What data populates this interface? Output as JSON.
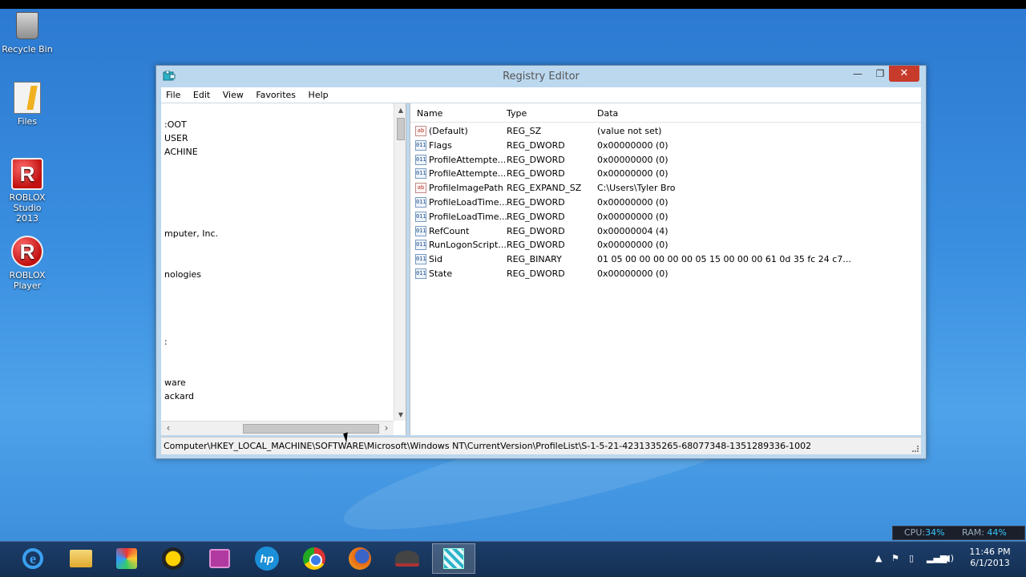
{
  "desktop": {
    "icons": [
      {
        "label": "Recycle Bin"
      },
      {
        "label": "Files"
      },
      {
        "label": "ROBLOX Studio 2013",
        "glyph": "R"
      },
      {
        "label": "ROBLOX Player",
        "glyph": "R"
      }
    ]
  },
  "window": {
    "title": "Registry Editor",
    "controls": {
      "minimize": "—",
      "maximize": "❐",
      "close": "✕"
    },
    "menu": [
      "File",
      "Edit",
      "View",
      "Favorites",
      "Help"
    ]
  },
  "tree": {
    "items": [
      ":OOT",
      "USER",
      "ACHINE",
      "mputer, Inc.",
      "nologies",
      ":",
      "ware",
      "ackard"
    ]
  },
  "list": {
    "columns": [
      "Name",
      "Type",
      "Data"
    ],
    "rows": [
      {
        "name": "(Default)",
        "type": "REG_SZ",
        "data": "(value not set)",
        "icon": "ab"
      },
      {
        "name": "Flags",
        "type": "REG_DWORD",
        "data": "0x00000000 (0)",
        "icon": "bin"
      },
      {
        "name": "ProfileAttempte...",
        "type": "REG_DWORD",
        "data": "0x00000000 (0)",
        "icon": "bin"
      },
      {
        "name": "ProfileAttempte...",
        "type": "REG_DWORD",
        "data": "0x00000000 (0)",
        "icon": "bin"
      },
      {
        "name": "ProfileImagePath",
        "type": "REG_EXPAND_SZ",
        "data": "C:\\Users\\Tyler Bro",
        "icon": "ab"
      },
      {
        "name": "ProfileLoadTime...",
        "type": "REG_DWORD",
        "data": "0x00000000 (0)",
        "icon": "bin"
      },
      {
        "name": "ProfileLoadTime...",
        "type": "REG_DWORD",
        "data": "0x00000000 (0)",
        "icon": "bin"
      },
      {
        "name": "RefCount",
        "type": "REG_DWORD",
        "data": "0x00000004 (4)",
        "icon": "bin"
      },
      {
        "name": "RunLogonScript...",
        "type": "REG_DWORD",
        "data": "0x00000000 (0)",
        "icon": "bin"
      },
      {
        "name": "Sid",
        "type": "REG_BINARY",
        "data": "01 05 00 00 00 00 00 05 15 00 00 00 61 0d 35 fc 24 c7...",
        "icon": "bin"
      },
      {
        "name": "State",
        "type": "REG_DWORD",
        "data": "0x00000000 (0)",
        "icon": "bin"
      }
    ]
  },
  "statusbar": {
    "path": "Computer\\HKEY_LOCAL_MACHINE\\SOFTWARE\\Microsoft\\Windows NT\\CurrentVersion\\ProfileList\\S-1-5-21-4231335265-68077348-1351289336-1002"
  },
  "gadget": {
    "cpu_label": "CPU:",
    "cpu_value": "34%",
    "ram_label": "RAM:",
    "ram_value": "44%"
  },
  "taskbar": {
    "apps": [
      "internet-explorer",
      "file-explorer",
      "colorful-app",
      "norton",
      "purple-app",
      "hp",
      "chrome",
      "firefox",
      "hat-app",
      "registry-editor"
    ],
    "clock_time": "11:46 PM",
    "clock_date": "6/1/2013",
    "tray_icons": [
      "show-hidden-icon",
      "action-center-icon",
      "power-icon",
      "network-icon",
      "volume-icon"
    ]
  },
  "colors": {
    "close_button": "#c73b2c",
    "gadget_accent": "#38c8ff",
    "taskbar": "#1c3e6a"
  }
}
